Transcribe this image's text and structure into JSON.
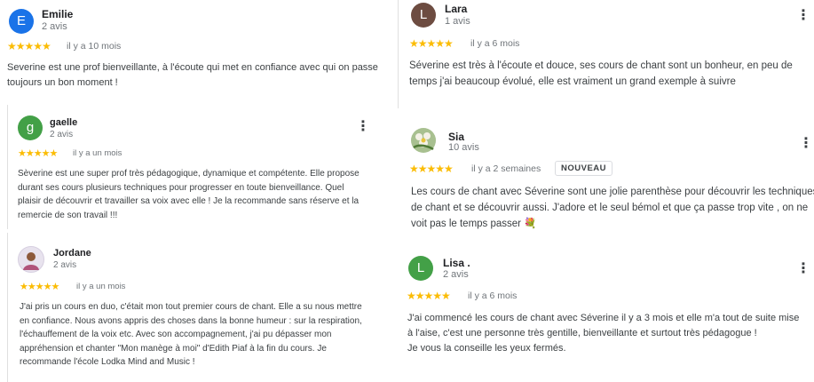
{
  "colors": {
    "star": "#fbbc04",
    "avatar_emilie": "#1a73e8",
    "avatar_gaelle": "#43a047",
    "avatar_lara": "#6d4c41",
    "avatar_lisa": "#43a047"
  },
  "reviews": [
    {
      "name": "Emilie",
      "avatar_letter": "E",
      "count": "2 avis",
      "stars": "★★★★★",
      "rating": 5,
      "date": "il y a 10 mois",
      "text": "Severine est une prof bienveillante, à l'écoute qui met en confiance avec qui on passe toujours un bon moment !"
    },
    {
      "name": "gaelle",
      "avatar_letter": "g",
      "count": "2 avis",
      "stars": "★★★★★",
      "rating": 5,
      "date": "il y a un mois",
      "text": "Sèverine est une super prof très pédagogique, dynamique et compétente. Elle propose durant ses cours plusieurs techniques pour progresser en toute bienveillance. Quel plaisir de découvrir et travailler sa voix avec elle ! Je la recommande sans réserve et la remercie de son travail !!!"
    },
    {
      "name": "Jordane ",
      "count": "2 avis",
      "stars": "★★★★★",
      "rating": 5,
      "date": "il y a un mois",
      "text": "J'ai pris un cours en duo, c'était mon tout premier cours de chant. Elle a su nous mettre en confiance. Nous avons appris des choses dans la bonne humeur : sur la respiration, l'échauffement de la voix etc. Avec son accompagnement, j'ai pu dépasser mon appréhension et chanter \"Mon manège à moi\" d'Edith Piaf à la fin du cours. Je recommande l'école Lodka Mind and Music !"
    },
    {
      "name": "Lara",
      "avatar_letter": "L",
      "count": "1 avis",
      "stars": "★★★★★",
      "rating": 5,
      "date": "il y a 6 mois",
      "text": "Séverine est très à l'écoute et douce, ses cours de chant sont un bonheur, en peu de temps j'ai beaucoup évolué, elle est vraiment un grand exemple à suivre"
    },
    {
      "name": "Sia",
      "count": "10 avis",
      "stars": "★★★★★",
      "rating": 5,
      "date": "il y a 2 semaines",
      "badge": "NOUVEAU",
      "text": "Les cours de chant avec Séverine sont une jolie parenthèse pour découvrir les techniques de chant et se découvrir aussi. J'adore et le seul bémol et que ça passe trop vite , on ne voit pas le temps passer 💐"
    },
    {
      "name": "Lisa .",
      "avatar_letter": "L",
      "count": "2 avis",
      "stars": "★★★★★",
      "rating": 5,
      "date": "il y a 6 mois",
      "text_lines": [
        "J'ai commencé les cours de chant avec Séverine il y a 3 mois et elle m'a tout de suite mise à l'aise, c'est une personne très gentille, bienveillante et surtout très pédagogue !",
        "Je vous la conseille les yeux fermés."
      ]
    }
  ],
  "more_icon": "⋮"
}
